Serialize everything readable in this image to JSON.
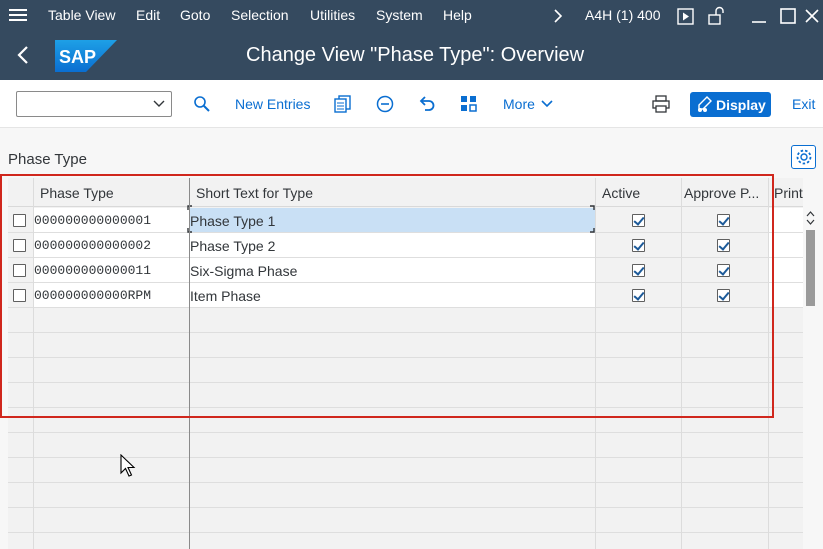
{
  "menubar": {
    "items": [
      "Table View",
      "Edit",
      "Goto",
      "Selection",
      "Utilities",
      "System",
      "Help"
    ],
    "system_info": "A4H (1) 400"
  },
  "titlebar": {
    "logo_text": "SAP",
    "title": "Change View \"Phase Type\": Overview"
  },
  "toolbar": {
    "combo_value": "",
    "new_entries": "New Entries",
    "more": "More",
    "display": "Display",
    "exit": "Exit"
  },
  "section": {
    "title": "Phase Type"
  },
  "table": {
    "columns": [
      "Phase Type",
      "Short Text for Type",
      "Active",
      "Approve P...",
      "Print"
    ],
    "rows": [
      {
        "phase_type": "000000000000001",
        "short_text": "Phase Type 1",
        "active": true,
        "approve": true
      },
      {
        "phase_type": "000000000000002",
        "short_text": "Phase Type 2",
        "active": true,
        "approve": true
      },
      {
        "phase_type": "000000000000011",
        "short_text": "Six-Sigma Phase",
        "active": true,
        "approve": true
      },
      {
        "phase_type": "000000000000RPM",
        "short_text": "Item Phase",
        "active": true,
        "approve": true
      }
    ]
  },
  "colors": {
    "shell": "#354a5f",
    "accent": "#0a6ed1",
    "annotation": "#d0271d",
    "selected_cell": "#c9e0f5"
  },
  "icons": [
    "menu-icon",
    "chevron-right-icon",
    "play-icon",
    "unlock-icon",
    "minimize-icon",
    "maximize-icon",
    "close-icon",
    "back-icon",
    "zoom-icon",
    "copy-icon",
    "delete-icon",
    "undo-icon",
    "select-all-icon",
    "print-icon",
    "pencil-glasses-icon",
    "settings-icon"
  ]
}
